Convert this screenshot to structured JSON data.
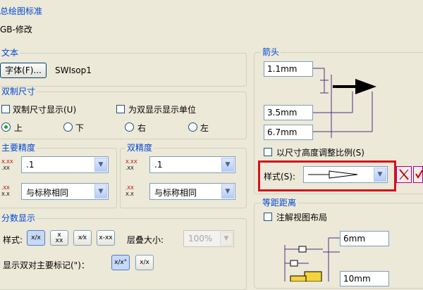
{
  "header": {
    "standard_label": "总绘图标准",
    "standard_value": "GB-修改"
  },
  "text_group": {
    "title": "文本",
    "font_button": "字体(F)...",
    "font_name": "SWIsop1"
  },
  "dual_group": {
    "title": "双制尺寸",
    "show_dual": "双制尺寸显示(U)",
    "show_units": "为双显示显示单位",
    "pos_top": "上",
    "pos_bottom": "下",
    "pos_right": "右",
    "pos_left": "左"
  },
  "primary_precision": {
    "title": "主要精度",
    "value1": ".1",
    "value2": "与标称相同"
  },
  "dual_precision": {
    "title": "双精度",
    "value1": ".1",
    "value2": "与标称相同"
  },
  "fraction_group": {
    "title": "分数显示",
    "style_label": "样式:",
    "stack_label": "层叠大小:",
    "stack_value": "100%",
    "show_dual_label": "显示双对主要标记(\")："
  },
  "arrow_group": {
    "title": "箭头",
    "size1": "1.1mm",
    "size2": "3.5mm",
    "size3": "6.7mm",
    "scale_checkbox": "以尺寸高度调整比例(S)",
    "style_label": "样式(S):"
  },
  "offset_group": {
    "title": "等距距离",
    "checkbox": "注解视图布局",
    "value1": "6mm",
    "value2": "10mm"
  },
  "colors": {
    "highlight": "#d5121b",
    "group_title": "#0046d5"
  }
}
